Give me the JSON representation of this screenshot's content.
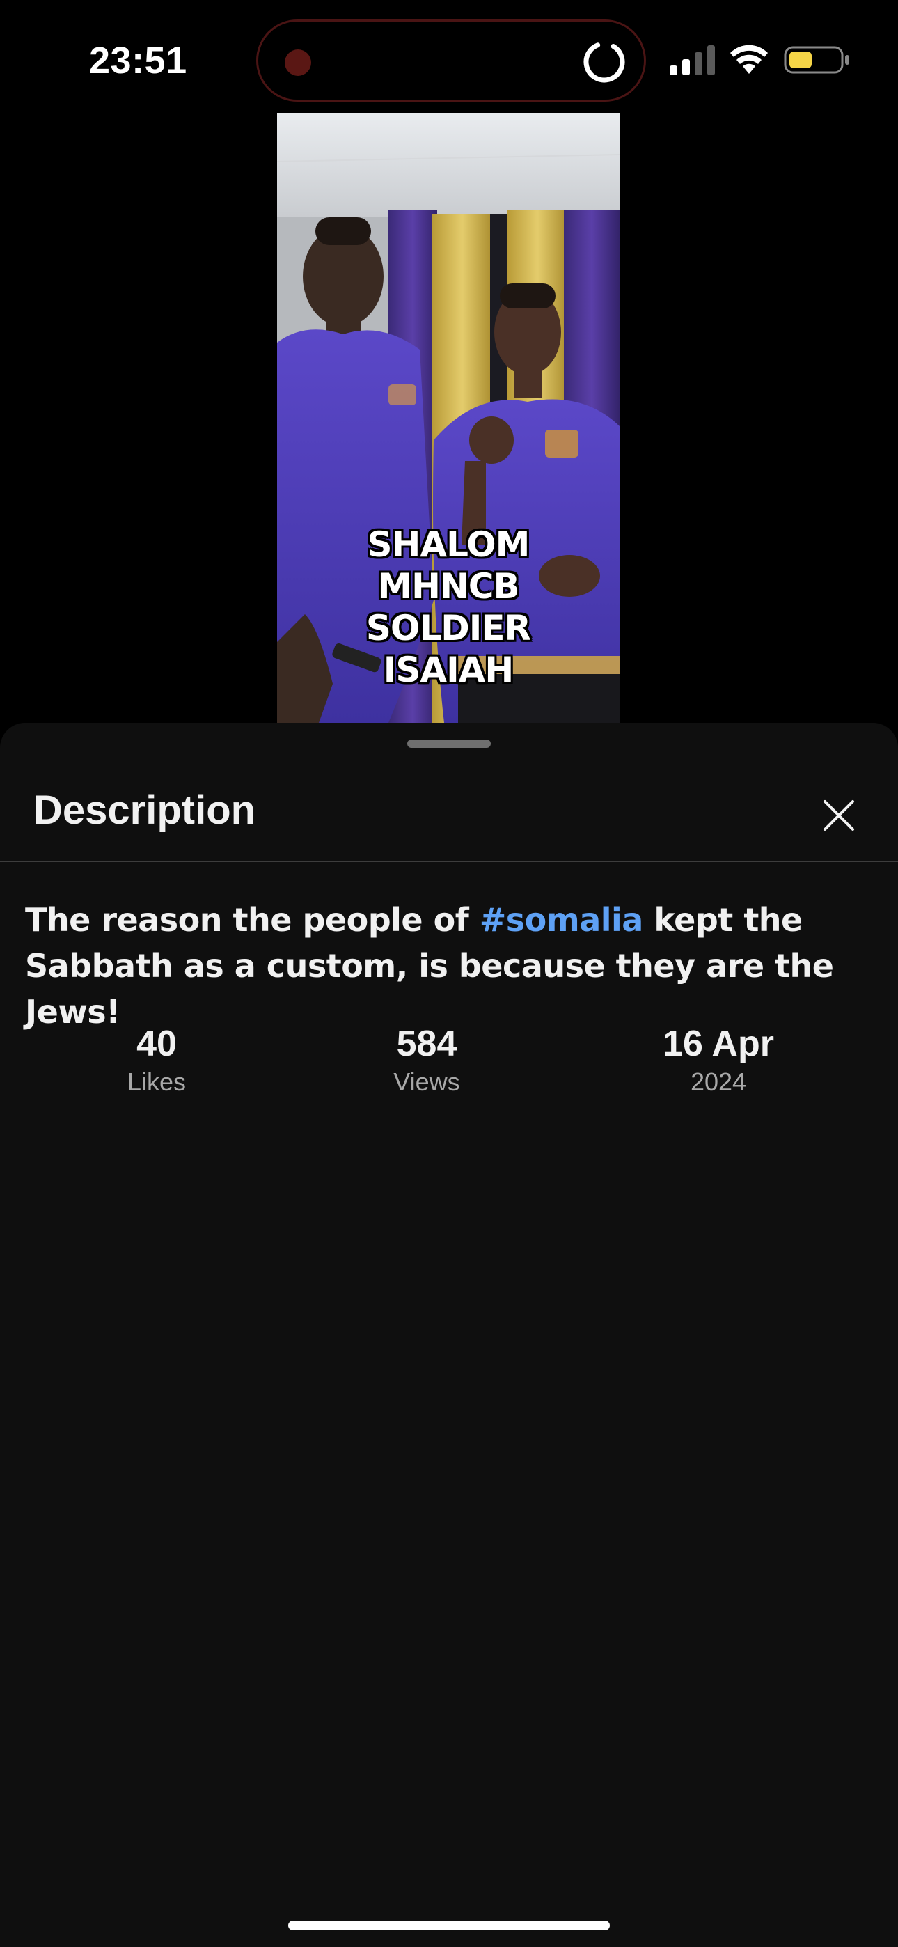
{
  "status_bar": {
    "time": "23:51",
    "signal_bars_active": 2,
    "battery_level": 0.45,
    "battery_color": "#f5d547"
  },
  "video": {
    "caption_lines": [
      "SHALOM",
      "MHNCB",
      "SOLDIER",
      "ISAIAH"
    ]
  },
  "sheet": {
    "title": "Description",
    "close_icon": "close-icon",
    "description": {
      "before": "The reason the people of ",
      "hashtag": "#somalia",
      "after": " kept the Sabbath as a custom, is because they are the Jews!"
    },
    "stats": {
      "likes": {
        "value": "40",
        "label": "Likes"
      },
      "views": {
        "value": "584",
        "label": "Views"
      },
      "date": {
        "value": "16 Apr",
        "label": "2024"
      }
    }
  },
  "colors": {
    "sheet_background": "#0f0f0f",
    "link": "#5ea1f5"
  }
}
